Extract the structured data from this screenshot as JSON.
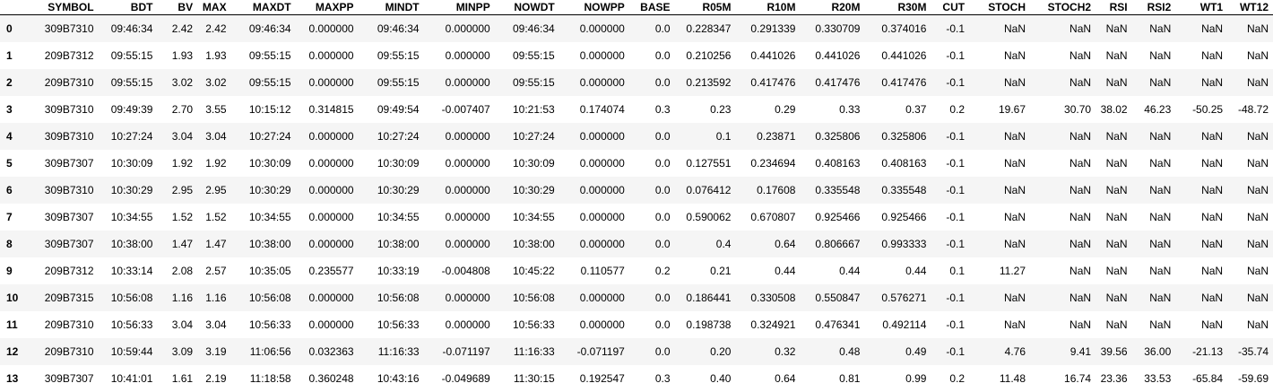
{
  "table": {
    "index_header": "",
    "columns": [
      "SYMBOL",
      "BDT",
      "BV",
      "MAX",
      "MAXDT",
      "MAXPP",
      "MINDT",
      "MINPP",
      "NOWDT",
      "NOWPP",
      "BASE",
      "R05M",
      "R10M",
      "R20M",
      "R30M",
      "CUT",
      "STOCH",
      "STOCH2",
      "RSI",
      "RSI2",
      "WT1",
      "WT12"
    ],
    "rows": [
      {
        "index": "0",
        "cells": [
          "309B7310",
          "09:46:34",
          "2.42",
          "2.42",
          "09:46:34",
          "0.000000",
          "09:46:34",
          "0.000000",
          "09:46:34",
          "0.000000",
          "0.0",
          "0.228347",
          "0.291339",
          "0.330709",
          "0.374016",
          "-0.1",
          "NaN",
          "NaN",
          "NaN",
          "NaN",
          "NaN",
          "NaN"
        ]
      },
      {
        "index": "1",
        "cells": [
          "209B7312",
          "09:55:15",
          "1.93",
          "1.93",
          "09:55:15",
          "0.000000",
          "09:55:15",
          "0.000000",
          "09:55:15",
          "0.000000",
          "0.0",
          "0.210256",
          "0.441026",
          "0.441026",
          "0.441026",
          "-0.1",
          "NaN",
          "NaN",
          "NaN",
          "NaN",
          "NaN",
          "NaN"
        ]
      },
      {
        "index": "2",
        "cells": [
          "209B7310",
          "09:55:15",
          "3.02",
          "3.02",
          "09:55:15",
          "0.000000",
          "09:55:15",
          "0.000000",
          "09:55:15",
          "0.000000",
          "0.0",
          "0.213592",
          "0.417476",
          "0.417476",
          "0.417476",
          "-0.1",
          "NaN",
          "NaN",
          "NaN",
          "NaN",
          "NaN",
          "NaN"
        ]
      },
      {
        "index": "3",
        "cells": [
          "309B7310",
          "09:49:39",
          "2.70",
          "3.55",
          "10:15:12",
          "0.314815",
          "09:49:54",
          "-0.007407",
          "10:21:53",
          "0.174074",
          "0.3",
          "0.23",
          "0.29",
          "0.33",
          "0.37",
          "0.2",
          "19.67",
          "30.70",
          "38.02",
          "46.23",
          "-50.25",
          "-48.72"
        ]
      },
      {
        "index": "4",
        "cells": [
          "309B7310",
          "10:27:24",
          "3.04",
          "3.04",
          "10:27:24",
          "0.000000",
          "10:27:24",
          "0.000000",
          "10:27:24",
          "0.000000",
          "0.0",
          "0.1",
          "0.23871",
          "0.325806",
          "0.325806",
          "-0.1",
          "NaN",
          "NaN",
          "NaN",
          "NaN",
          "NaN",
          "NaN"
        ]
      },
      {
        "index": "5",
        "cells": [
          "309B7307",
          "10:30:09",
          "1.92",
          "1.92",
          "10:30:09",
          "0.000000",
          "10:30:09",
          "0.000000",
          "10:30:09",
          "0.000000",
          "0.0",
          "0.127551",
          "0.234694",
          "0.408163",
          "0.408163",
          "-0.1",
          "NaN",
          "NaN",
          "NaN",
          "NaN",
          "NaN",
          "NaN"
        ]
      },
      {
        "index": "6",
        "cells": [
          "309B7310",
          "10:30:29",
          "2.95",
          "2.95",
          "10:30:29",
          "0.000000",
          "10:30:29",
          "0.000000",
          "10:30:29",
          "0.000000",
          "0.0",
          "0.076412",
          "0.17608",
          "0.335548",
          "0.335548",
          "-0.1",
          "NaN",
          "NaN",
          "NaN",
          "NaN",
          "NaN",
          "NaN"
        ]
      },
      {
        "index": "7",
        "cells": [
          "309B7307",
          "10:34:55",
          "1.52",
          "1.52",
          "10:34:55",
          "0.000000",
          "10:34:55",
          "0.000000",
          "10:34:55",
          "0.000000",
          "0.0",
          "0.590062",
          "0.670807",
          "0.925466",
          "0.925466",
          "-0.1",
          "NaN",
          "NaN",
          "NaN",
          "NaN",
          "NaN",
          "NaN"
        ]
      },
      {
        "index": "8",
        "cells": [
          "309B7307",
          "10:38:00",
          "1.47",
          "1.47",
          "10:38:00",
          "0.000000",
          "10:38:00",
          "0.000000",
          "10:38:00",
          "0.000000",
          "0.0",
          "0.4",
          "0.64",
          "0.806667",
          "0.993333",
          "-0.1",
          "NaN",
          "NaN",
          "NaN",
          "NaN",
          "NaN",
          "NaN"
        ]
      },
      {
        "index": "9",
        "cells": [
          "209B7312",
          "10:33:14",
          "2.08",
          "2.57",
          "10:35:05",
          "0.235577",
          "10:33:19",
          "-0.004808",
          "10:45:22",
          "0.110577",
          "0.2",
          "0.21",
          "0.44",
          "0.44",
          "0.44",
          "0.1",
          "11.27",
          "NaN",
          "NaN",
          "NaN",
          "NaN",
          "NaN"
        ]
      },
      {
        "index": "10",
        "cells": [
          "209B7315",
          "10:56:08",
          "1.16",
          "1.16",
          "10:56:08",
          "0.000000",
          "10:56:08",
          "0.000000",
          "10:56:08",
          "0.000000",
          "0.0",
          "0.186441",
          "0.330508",
          "0.550847",
          "0.576271",
          "-0.1",
          "NaN",
          "NaN",
          "NaN",
          "NaN",
          "NaN",
          "NaN"
        ]
      },
      {
        "index": "11",
        "cells": [
          "209B7310",
          "10:56:33",
          "3.04",
          "3.04",
          "10:56:33",
          "0.000000",
          "10:56:33",
          "0.000000",
          "10:56:33",
          "0.000000",
          "0.0",
          "0.198738",
          "0.324921",
          "0.476341",
          "0.492114",
          "-0.1",
          "NaN",
          "NaN",
          "NaN",
          "NaN",
          "NaN",
          "NaN"
        ]
      },
      {
        "index": "12",
        "cells": [
          "209B7310",
          "10:59:44",
          "3.09",
          "3.19",
          "11:06:56",
          "0.032363",
          "11:16:33",
          "-0.071197",
          "11:16:33",
          "-0.071197",
          "0.0",
          "0.20",
          "0.32",
          "0.48",
          "0.49",
          "-0.1",
          "4.76",
          "9.41",
          "39.56",
          "36.00",
          "-21.13",
          "-35.74"
        ]
      },
      {
        "index": "13",
        "cells": [
          "309B7307",
          "10:41:01",
          "1.61",
          "2.19",
          "11:18:58",
          "0.360248",
          "10:43:16",
          "-0.049689",
          "11:30:15",
          "0.192547",
          "0.3",
          "0.40",
          "0.64",
          "0.81",
          "0.99",
          "0.2",
          "11.48",
          "16.74",
          "23.36",
          "33.53",
          "-65.84",
          "-59.69"
        ]
      }
    ]
  }
}
